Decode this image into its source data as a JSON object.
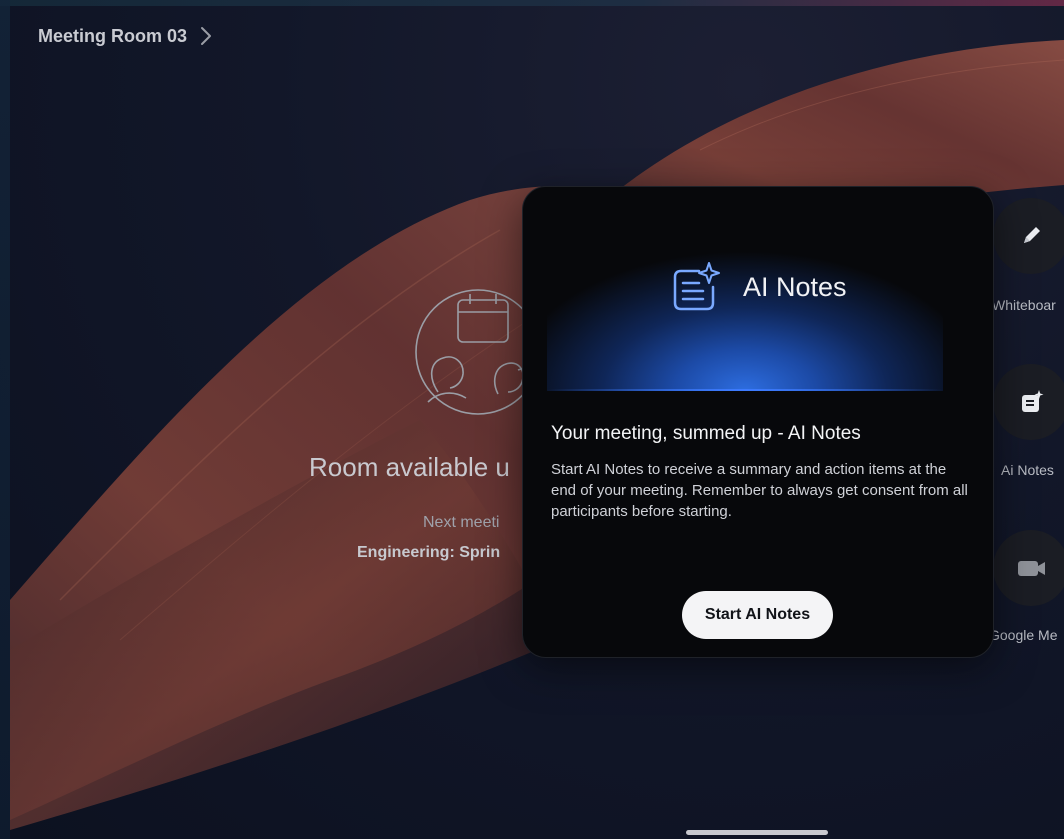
{
  "header": {
    "room_name": "Meeting Room 03"
  },
  "status": {
    "room_available": "Room available u",
    "next_meeting_label": "Next meeti",
    "next_meeting_name": "Engineering: Sprin"
  },
  "side_actions": [
    {
      "label": "Whiteboar",
      "icon": "pencil-icon"
    },
    {
      "label": "Ai Notes",
      "icon": "ai-notes-icon"
    },
    {
      "label": "Google Me",
      "icon": "video-camera-icon"
    }
  ],
  "modal": {
    "title": "AI Notes",
    "heading": "Your meeting, summed up - AI Notes",
    "body": "Start AI Notes to receive a summary and action items at the end of your meeting. Remember to always get consent from all participants before starting.",
    "button_label": "Start AI Notes"
  },
  "colors": {
    "accent_blue": "#3d7bff",
    "ribbon": "#7a3f38",
    "background": "#0e1424"
  }
}
